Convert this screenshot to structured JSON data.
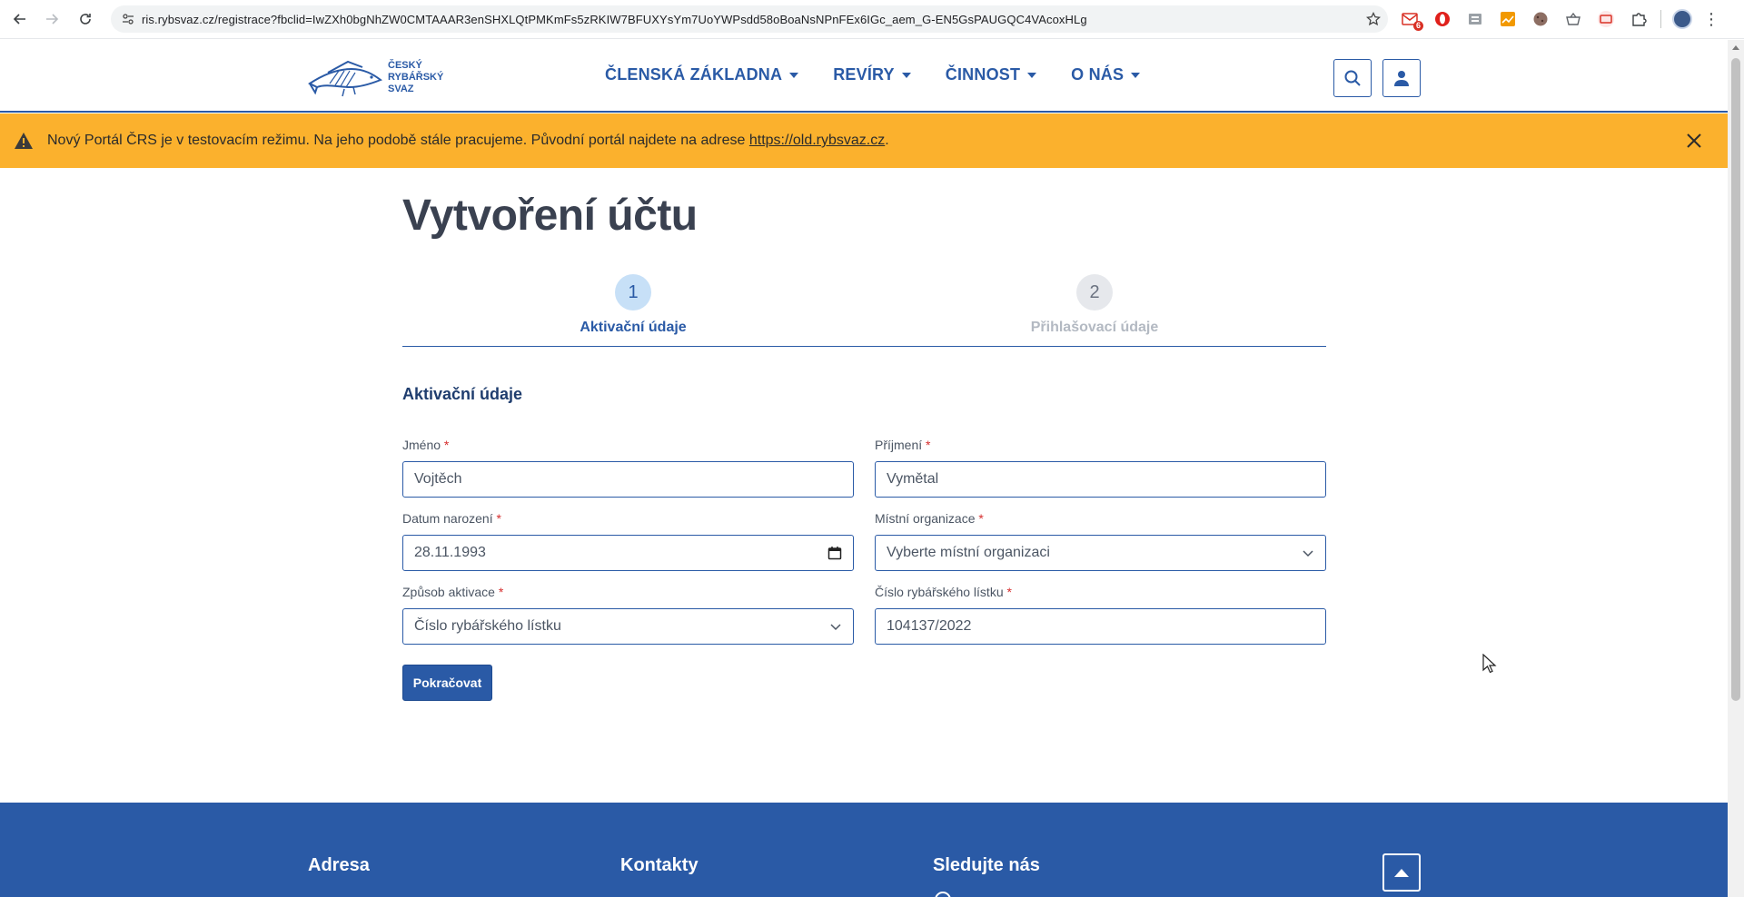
{
  "browser": {
    "url": "ris.rybsvaz.cz/registrace?fbclid=IwZXh0bgNhZW0CMTAAAR3enSHXLQtPMKmFs5zRKIW7BFUXYsYm7UoYWPsdd58oBoaNsNPnFEx6IGc_aem_G-EN5GsPAUGQC4VAcoxHLg",
    "extension_badge": "6"
  },
  "header": {
    "logo_lines": [
      "ČESKÝ",
      "RYBÁŘSKÝ",
      "SVAZ"
    ],
    "nav": [
      {
        "label": "ČLENSKÁ ZÁKLADNA"
      },
      {
        "label": "REVÍRY"
      },
      {
        "label": "ČINNOST"
      },
      {
        "label": "O NÁS"
      }
    ]
  },
  "alert": {
    "text": "Nový Portál ČRS je v testovacím režimu. Na jeho podobě stále pracujeme. Původní portál najdete na adrese ",
    "link": "https://old.rybsvaz.cz",
    "suffix": ".",
    "bg_color": "#fbb12d"
  },
  "main": {
    "title": "Vytvoření účtu",
    "steps": [
      {
        "number": "1",
        "label": "Aktivační údaje",
        "state": "active"
      },
      {
        "number": "2",
        "label": "Přihlašovací údaje",
        "state": "inactive"
      }
    ],
    "section_title": "Aktivační údaje",
    "fields": {
      "first_name": {
        "label": "Jméno",
        "value": "Vojtěch"
      },
      "last_name": {
        "label": "Příjmení",
        "value": "Vymětal"
      },
      "birth_date": {
        "label": "Datum narození",
        "value": "28.11.1993"
      },
      "local_org": {
        "label": "Místní organizace",
        "value": "Vyberte místní organizaci"
      },
      "activation_method": {
        "label": "Způsob aktivace",
        "value": "Číslo rybářského lístku"
      },
      "license_number": {
        "label": "Číslo rybářského lístku",
        "value": "104137/2022"
      }
    },
    "required_marker": "*",
    "continue_label": "Pokračovat"
  },
  "footer": {
    "columns": [
      "Adresa",
      "Kontakty",
      "Sledujte nás"
    ]
  },
  "colors": {
    "brand_blue": "#2a5aa6",
    "required_red": "#d62e2e"
  }
}
